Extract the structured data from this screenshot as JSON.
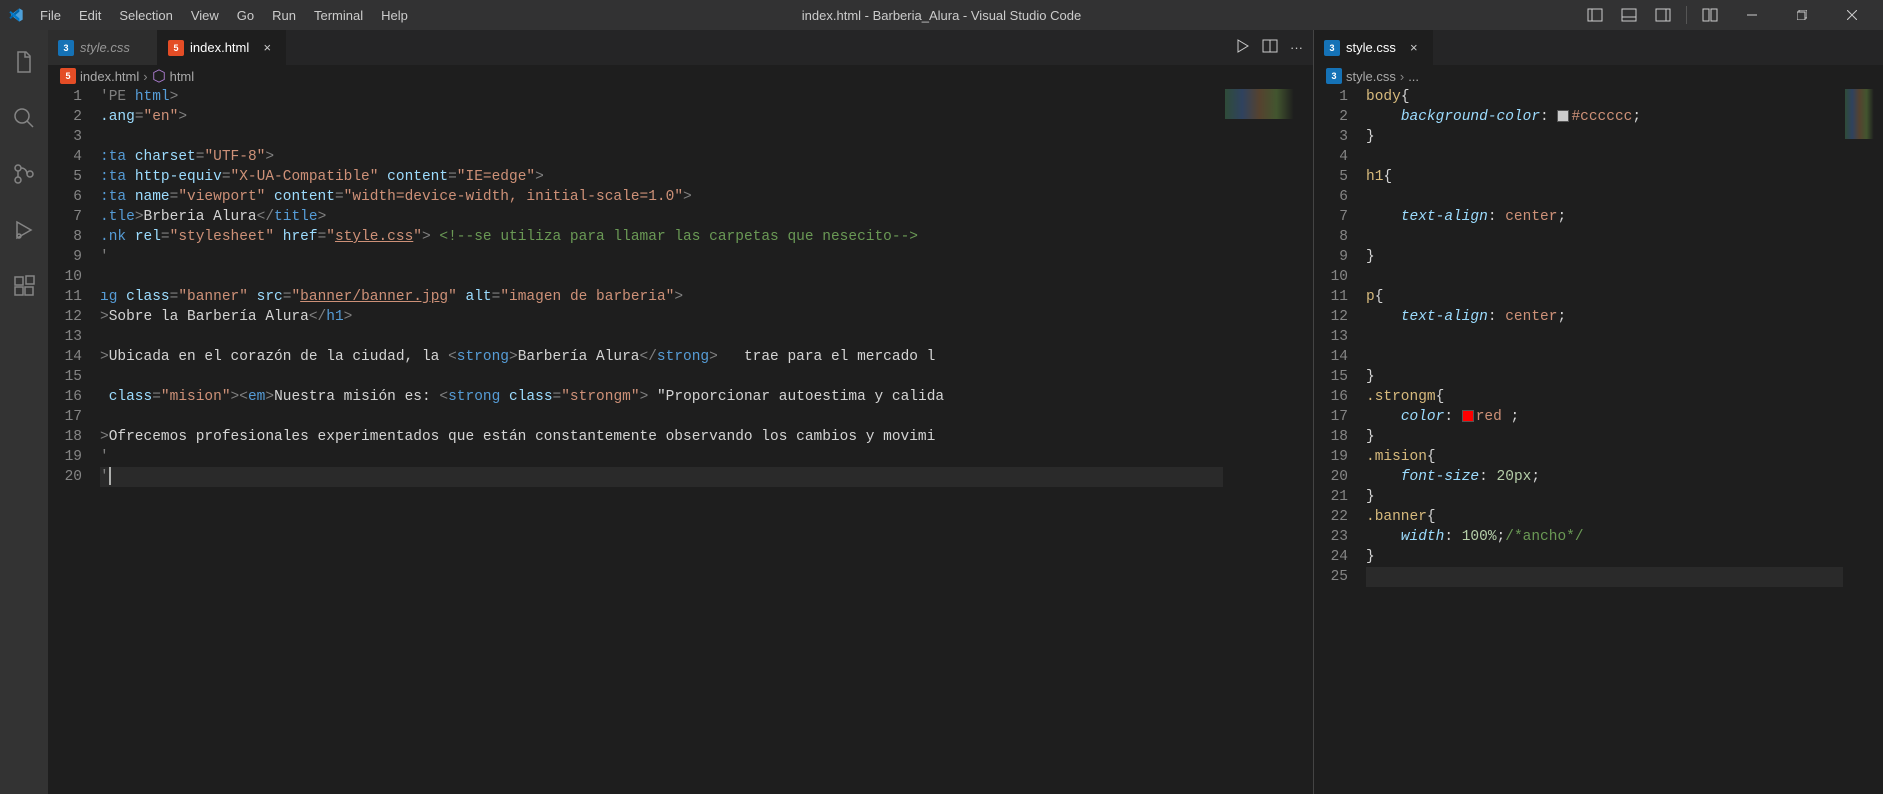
{
  "titlebar": {
    "menu": [
      "File",
      "Edit",
      "Selection",
      "View",
      "Go",
      "Run",
      "Terminal",
      "Help"
    ],
    "title": "index.html - Barberia_Alura - Visual Studio Code"
  },
  "left_group": {
    "tabs": [
      {
        "label": "style.css",
        "active": false,
        "icon": "css"
      },
      {
        "label": "index.html",
        "active": true,
        "icon": "html"
      }
    ],
    "breadcrumb": {
      "file": "index.html",
      "symbol": "html"
    },
    "lines": [
      {
        "n": 1,
        "tokens": [
          [
            "tk-pun",
            "'PE "
          ],
          [
            "tk-tag",
            "html"
          ],
          [
            "tk-pun",
            ">"
          ]
        ]
      },
      {
        "n": 2,
        "tokens": [
          [
            "tk-attr",
            ".ang"
          ],
          [
            "tk-pun",
            "="
          ],
          [
            "tk-str",
            "\"en\""
          ],
          [
            "tk-pun",
            ">"
          ]
        ]
      },
      {
        "n": 3,
        "tokens": []
      },
      {
        "n": 4,
        "tokens": [
          [
            "tk-tag",
            ":ta "
          ],
          [
            "tk-attr",
            "charset"
          ],
          [
            "tk-pun",
            "="
          ],
          [
            "tk-str",
            "\"UTF-8\""
          ],
          [
            "tk-pun",
            ">"
          ]
        ]
      },
      {
        "n": 5,
        "tokens": [
          [
            "tk-tag",
            ":ta "
          ],
          [
            "tk-attr",
            "http-equiv"
          ],
          [
            "tk-pun",
            "="
          ],
          [
            "tk-str",
            "\"X-UA-Compatible\""
          ],
          [
            "tk-txt",
            " "
          ],
          [
            "tk-attr",
            "content"
          ],
          [
            "tk-pun",
            "="
          ],
          [
            "tk-str",
            "\"IE=edge\""
          ],
          [
            "tk-pun",
            ">"
          ]
        ]
      },
      {
        "n": 6,
        "tokens": [
          [
            "tk-tag",
            ":ta "
          ],
          [
            "tk-attr",
            "name"
          ],
          [
            "tk-pun",
            "="
          ],
          [
            "tk-str",
            "\"viewport\""
          ],
          [
            "tk-txt",
            " "
          ],
          [
            "tk-attr",
            "content"
          ],
          [
            "tk-pun",
            "="
          ],
          [
            "tk-str",
            "\"width=device-width, initial-scale=1.0\""
          ],
          [
            "tk-pun",
            ">"
          ]
        ]
      },
      {
        "n": 7,
        "tokens": [
          [
            "tk-tag",
            ".tle"
          ],
          [
            "tk-pun",
            ">"
          ],
          [
            "tk-txt",
            "Brberia Alura"
          ],
          [
            "tk-pun",
            "</"
          ],
          [
            "tk-tag",
            "title"
          ],
          [
            "tk-pun",
            ">"
          ]
        ]
      },
      {
        "n": 8,
        "tokens": [
          [
            "tk-tag",
            ".nk "
          ],
          [
            "tk-attr",
            "rel"
          ],
          [
            "tk-pun",
            "="
          ],
          [
            "tk-str",
            "\"stylesheet\""
          ],
          [
            "tk-txt",
            " "
          ],
          [
            "tk-attr",
            "href"
          ],
          [
            "tk-pun",
            "="
          ],
          [
            "tk-str",
            "\""
          ],
          [
            "tk-link",
            "style.css"
          ],
          [
            "tk-str",
            "\""
          ],
          [
            "tk-pun",
            "> "
          ],
          [
            "tk-cmt",
            "<!--se utiliza para llamar las carpetas que nesecito-->"
          ]
        ]
      },
      {
        "n": 9,
        "tokens": [
          [
            "tk-pun",
            "'"
          ]
        ]
      },
      {
        "n": 10,
        "tokens": []
      },
      {
        "n": 11,
        "tokens": [
          [
            "tk-tag",
            "ıg "
          ],
          [
            "tk-attr",
            "class"
          ],
          [
            "tk-pun",
            "="
          ],
          [
            "tk-str",
            "\"banner\""
          ],
          [
            "tk-txt",
            " "
          ],
          [
            "tk-attr",
            "src"
          ],
          [
            "tk-pun",
            "="
          ],
          [
            "tk-str",
            "\""
          ],
          [
            "tk-link",
            "banner/banner.jpg"
          ],
          [
            "tk-str",
            "\""
          ],
          [
            "tk-txt",
            " "
          ],
          [
            "tk-attr",
            "alt"
          ],
          [
            "tk-pun",
            "="
          ],
          [
            "tk-str",
            "\"imagen de barberia\""
          ],
          [
            "tk-pun",
            ">"
          ]
        ]
      },
      {
        "n": 12,
        "tokens": [
          [
            "tk-pun",
            ">"
          ],
          [
            "tk-txt",
            "Sobre la Barbería Alura"
          ],
          [
            "tk-pun",
            "</"
          ],
          [
            "tk-tag",
            "h1"
          ],
          [
            "tk-pun",
            ">"
          ]
        ]
      },
      {
        "n": 13,
        "tokens": []
      },
      {
        "n": 14,
        "tokens": [
          [
            "tk-pun",
            ">"
          ],
          [
            "tk-txt",
            "Ubicada en el corazón de la ciudad, la "
          ],
          [
            "tk-pun",
            "<"
          ],
          [
            "tk-tag",
            "strong"
          ],
          [
            "tk-pun",
            ">"
          ],
          [
            "tk-txt",
            "Barbería Alura"
          ],
          [
            "tk-pun",
            "</"
          ],
          [
            "tk-tag",
            "strong"
          ],
          [
            "tk-pun",
            ">"
          ],
          [
            "tk-txt",
            "   trae para el mercado l"
          ]
        ]
      },
      {
        "n": 15,
        "tokens": []
      },
      {
        "n": 16,
        "tokens": [
          [
            "tk-attr",
            " class"
          ],
          [
            "tk-pun",
            "="
          ],
          [
            "tk-str",
            "\"mision\""
          ],
          [
            "tk-pun",
            "><"
          ],
          [
            "tk-tag",
            "em"
          ],
          [
            "tk-pun",
            ">"
          ],
          [
            "tk-txt",
            "Nuestra misión es: "
          ],
          [
            "tk-pun",
            "<"
          ],
          [
            "tk-tag",
            "strong"
          ],
          [
            "tk-txt",
            " "
          ],
          [
            "tk-attr",
            "class"
          ],
          [
            "tk-pun",
            "="
          ],
          [
            "tk-str",
            "\"strongm\""
          ],
          [
            "tk-pun",
            ">"
          ],
          [
            "tk-txt",
            " \"Proporcionar autoestima y calida"
          ]
        ]
      },
      {
        "n": 17,
        "tokens": []
      },
      {
        "n": 18,
        "tokens": [
          [
            "tk-pun",
            ">"
          ],
          [
            "tk-txt",
            "Ofrecemos profesionales experimentados que están constantemente observando los cambios y movimi"
          ]
        ]
      },
      {
        "n": 19,
        "tokens": [
          [
            "tk-pun",
            "'"
          ]
        ]
      },
      {
        "n": 20,
        "tokens": [
          [
            "tk-pun",
            "'"
          ],
          [
            "cursor",
            ""
          ]
        ],
        "current": true
      }
    ]
  },
  "right_group": {
    "tabs": [
      {
        "label": "style.css",
        "active": true,
        "icon": "css"
      }
    ],
    "breadcrumb": {
      "file": "style.css",
      "symbol": "..."
    },
    "lines": [
      {
        "n": 1,
        "tokens": [
          [
            "tk-sel",
            "body"
          ],
          [
            "tk-txt",
            "{"
          ]
        ]
      },
      {
        "n": 2,
        "tokens": [
          [
            "tk-txt",
            "    "
          ],
          [
            "tk-prop",
            "background-color"
          ],
          [
            "tk-txt",
            ": "
          ],
          [
            "swatch",
            "#cccccc"
          ],
          [
            "tk-val",
            "#cccccc"
          ],
          [
            "tk-txt",
            ";"
          ]
        ]
      },
      {
        "n": 3,
        "tokens": [
          [
            "tk-txt",
            "}"
          ]
        ]
      },
      {
        "n": 4,
        "tokens": []
      },
      {
        "n": 5,
        "tokens": [
          [
            "tk-sel",
            "h1"
          ],
          [
            "tk-txt",
            "{"
          ]
        ]
      },
      {
        "n": 6,
        "tokens": []
      },
      {
        "n": 7,
        "tokens": [
          [
            "tk-txt",
            "    "
          ],
          [
            "tk-prop",
            "text-align"
          ],
          [
            "tk-txt",
            ": "
          ],
          [
            "tk-val",
            "center"
          ],
          [
            "tk-txt",
            ";"
          ]
        ]
      },
      {
        "n": 8,
        "tokens": []
      },
      {
        "n": 9,
        "tokens": [
          [
            "tk-txt",
            "}"
          ]
        ]
      },
      {
        "n": 10,
        "tokens": []
      },
      {
        "n": 11,
        "tokens": [
          [
            "tk-sel",
            "p"
          ],
          [
            "tk-txt",
            "{"
          ]
        ]
      },
      {
        "n": 12,
        "tokens": [
          [
            "tk-txt",
            "    "
          ],
          [
            "tk-prop",
            "text-align"
          ],
          [
            "tk-txt",
            ": "
          ],
          [
            "tk-val",
            "center"
          ],
          [
            "tk-txt",
            ";"
          ]
        ]
      },
      {
        "n": 13,
        "tokens": []
      },
      {
        "n": 14,
        "tokens": []
      },
      {
        "n": 15,
        "tokens": [
          [
            "tk-txt",
            "}"
          ]
        ]
      },
      {
        "n": 16,
        "tokens": [
          [
            "tk-sel",
            ".strongm"
          ],
          [
            "tk-txt",
            "{"
          ]
        ]
      },
      {
        "n": 17,
        "tokens": [
          [
            "tk-txt",
            "    "
          ],
          [
            "tk-prop",
            "color"
          ],
          [
            "tk-txt",
            ": "
          ],
          [
            "swatch",
            "#ff0000"
          ],
          [
            "tk-val",
            "red "
          ],
          [
            "tk-txt",
            ";"
          ]
        ]
      },
      {
        "n": 18,
        "tokens": [
          [
            "tk-txt",
            "}"
          ]
        ]
      },
      {
        "n": 19,
        "tokens": [
          [
            "tk-sel",
            ".mision"
          ],
          [
            "tk-txt",
            "{"
          ]
        ]
      },
      {
        "n": 20,
        "tokens": [
          [
            "tk-txt",
            "    "
          ],
          [
            "tk-prop",
            "font-size"
          ],
          [
            "tk-txt",
            ": "
          ],
          [
            "tk-num",
            "20px"
          ],
          [
            "tk-txt",
            ";"
          ]
        ]
      },
      {
        "n": 21,
        "tokens": [
          [
            "tk-txt",
            "}"
          ]
        ]
      },
      {
        "n": 22,
        "tokens": [
          [
            "tk-sel",
            ".banner"
          ],
          [
            "tk-txt",
            "{"
          ]
        ]
      },
      {
        "n": 23,
        "tokens": [
          [
            "tk-txt",
            "    "
          ],
          [
            "tk-prop",
            "width"
          ],
          [
            "tk-txt",
            ": "
          ],
          [
            "tk-num",
            "100%"
          ],
          [
            "tk-txt",
            ";"
          ],
          [
            "tk-cmt",
            "/*ancho*/"
          ]
        ]
      },
      {
        "n": 24,
        "tokens": [
          [
            "tk-txt",
            "}"
          ]
        ]
      },
      {
        "n": 25,
        "tokens": [],
        "current": true
      }
    ]
  }
}
